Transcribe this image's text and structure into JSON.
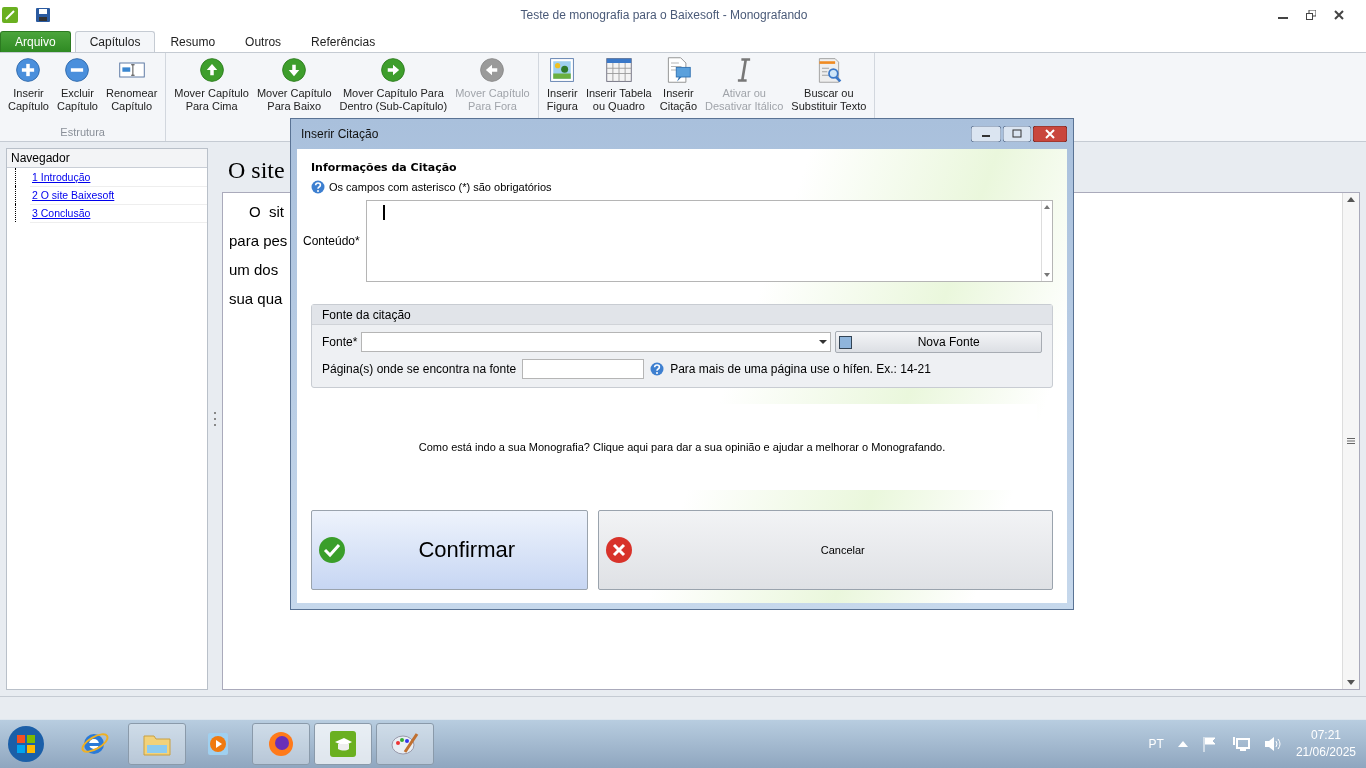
{
  "window": {
    "title": "Teste de monografia para o Baixesoft - Monografando"
  },
  "tabs": [
    {
      "label": "Arquivo",
      "kind": "file",
      "selected": false
    },
    {
      "label": "Capítulos",
      "kind": "tab",
      "selected": true
    },
    {
      "label": "Resumo",
      "kind": "tab",
      "selected": false
    },
    {
      "label": "Outros",
      "kind": "tab",
      "selected": false
    },
    {
      "label": "Referências",
      "kind": "tab",
      "selected": false
    }
  ],
  "ribbon_groups": [
    {
      "label": "Estrutura",
      "buttons": [
        {
          "kind": "plus",
          "lines": [
            "Inserir",
            "Capítulo"
          ],
          "disabled": false
        },
        {
          "kind": "minus",
          "lines": [
            "Excluir",
            "Capítulo"
          ],
          "disabled": false
        },
        {
          "kind": "rename",
          "lines": [
            "Renomear",
            "Capítulo"
          ],
          "disabled": false
        }
      ]
    },
    {
      "buttons": [
        {
          "kind": "up",
          "lines": [
            "Mover Capítulo",
            "Para Cima"
          ],
          "disabled": false
        },
        {
          "kind": "down",
          "lines": [
            "Mover Capítulo",
            "Para Baixo"
          ],
          "disabled": false
        },
        {
          "kind": "right",
          "lines": [
            "Mover Capítulo Para",
            "Dentro (Sub-Capítulo)"
          ],
          "disabled": false
        },
        {
          "kind": "left",
          "lines": [
            "Mover Capítulo",
            "Para Fora"
          ],
          "disabled": true
        }
      ]
    },
    {
      "buttons": [
        {
          "kind": "picture",
          "lines": [
            "Inserir",
            "Figura"
          ],
          "disabled": false
        },
        {
          "kind": "table",
          "lines": [
            "Inserir Tabela",
            "ou Quadro"
          ],
          "disabled": false
        },
        {
          "kind": "quote",
          "lines": [
            "Inserir",
            "Citação"
          ],
          "disabled": false
        },
        {
          "kind": "italic",
          "lines": [
            "Ativar ou",
            "Desativar Itálico"
          ],
          "disabled": true
        },
        {
          "kind": "find",
          "lines": [
            "Buscar ou",
            "Substituir Texto"
          ],
          "disabled": false
        }
      ]
    }
  ],
  "navigator": {
    "title": "Navegador",
    "items": [
      {
        "label": "1 Introdução"
      },
      {
        "label": "2 O site Baixesoft"
      },
      {
        "label": "3 Conclusão"
      }
    ]
  },
  "document": {
    "heading": "O site",
    "lines": [
      "O  sit",
      "para pes",
      "um dos",
      "sua qua"
    ]
  },
  "dialog": {
    "title": "Inserir Citação",
    "section_title": "Informações da Citação",
    "hint": "Os campos com asterisco (*) são obrigatórios",
    "content_label": "Conteúdo*",
    "source_group": {
      "title": "Fonte da citação",
      "source_label": "Fonte*",
      "new_source_button": "Nova Fonte",
      "page_label": "Página(s) onde se encontra na fonte",
      "page_hint": "Para mais de uma página use o hífen. Ex.: 14-21"
    },
    "feedback_banner": "Como está indo a sua Monografia? Clique aqui para dar a sua opinião e ajudar a melhorar o Monografando.",
    "confirm_button": "Confirmar",
    "cancel_button": "Cancelar"
  },
  "taskbar": {
    "apps": [
      {
        "kind": "ie",
        "open": false,
        "selected": false
      },
      {
        "kind": "folder",
        "open": true,
        "selected": false
      },
      {
        "kind": "media",
        "open": false,
        "selected": false
      },
      {
        "kind": "firefox",
        "open": true,
        "selected": false
      },
      {
        "kind": "monografando",
        "open": true,
        "selected": true
      },
      {
        "kind": "paint",
        "open": true,
        "selected": false
      }
    ],
    "language": "PT",
    "time": "07:21",
    "date": "21/06/2025"
  }
}
